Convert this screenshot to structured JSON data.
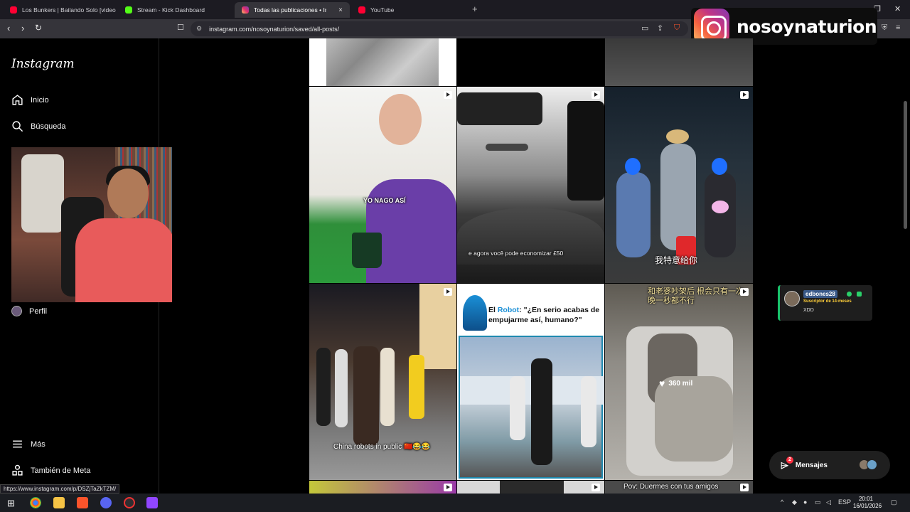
{
  "browser": {
    "tabs": [
      {
        "title": "Los Bunkers | Bailando Solo [video of",
        "favicon_color": "#ff0033"
      },
      {
        "title": "Stream - Kick Dashboard",
        "favicon_color": "#53fc18"
      },
      {
        "title": "Todas las publicaciones • Instagr",
        "favicon_color": "#e1306c"
      },
      {
        "title": "YouTube",
        "favicon_color": "#ff0033"
      }
    ],
    "close_tab": "×",
    "new_tab": "+",
    "url": "instagram.com/nosoynaturion/saved/all-posts/",
    "window": {
      "minimize": "–",
      "restore": "❐",
      "close": "✕"
    }
  },
  "overlay": {
    "username": "nosoynaturion"
  },
  "sidebar": {
    "brand": "Instagram",
    "items": [
      {
        "label": "Inicio",
        "icon": "home-icon"
      },
      {
        "label": "Búsqueda",
        "icon": "search-icon"
      },
      {
        "label": "Perfil",
        "icon": "avatar"
      }
    ],
    "bottom": [
      {
        "label": "Más",
        "icon": "menu-icon"
      },
      {
        "label": "También de Meta",
        "icon": "meta-icon"
      }
    ]
  },
  "feed": {
    "captions": {
      "yo_nago": "YO NAGO ASÍ",
      "economizar": "e agora você pode economizar £50",
      "chinese1": "我特意给你",
      "robot_title_part1": "El ",
      "robot_title_robot": "Robot",
      "robot_title_part2": ": \"¿En serio acabas de empujarme así, humano?\"",
      "china_robots": "China robots in public 🇨🇳😂😂",
      "chinese2": "和老婆吵架后 根会只有一次晚一秒都不行",
      "likes": "360 mil",
      "pov": "Pov: Duermes con tus amigos"
    }
  },
  "chat": {
    "username": "edbones28",
    "subtitle": "Suscriptor de 14-meses",
    "message": "XDD"
  },
  "messages": {
    "label": "Mensajes",
    "unread": "2"
  },
  "status_url": "https://www.instagram.com/p/DSZjTaZkTZM/",
  "taskbar": {
    "lang": "ESP",
    "time": "20:01",
    "date": "16/01/2026"
  }
}
